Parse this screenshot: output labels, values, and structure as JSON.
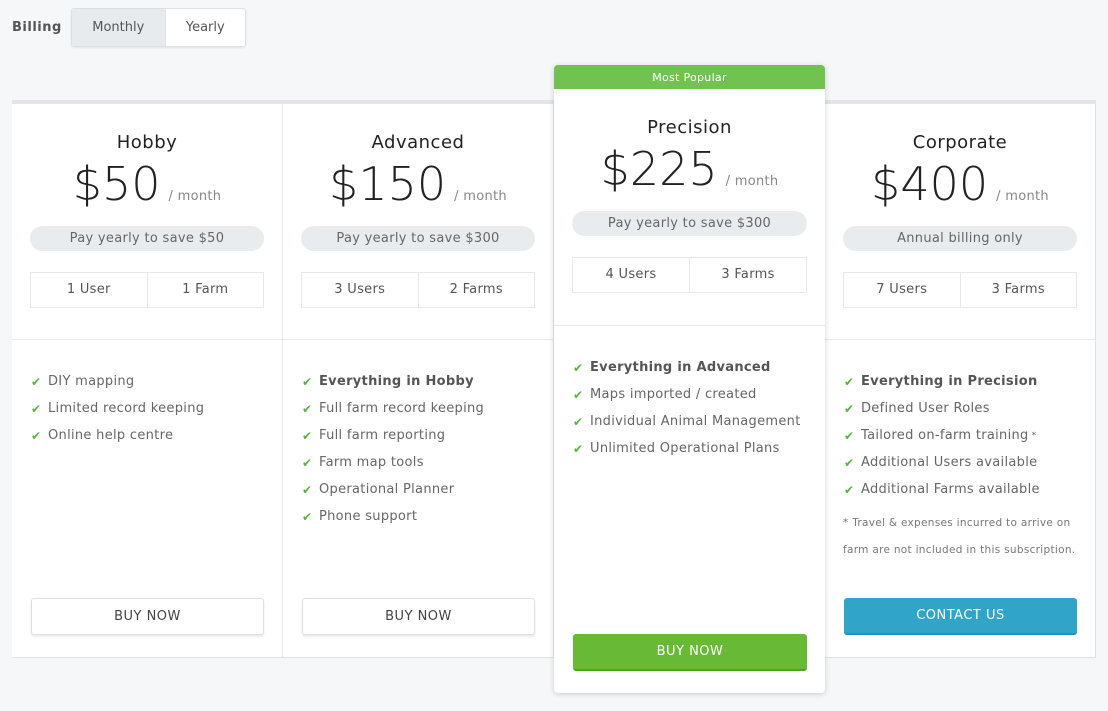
{
  "billing": {
    "label": "Billing",
    "options": [
      {
        "label": "Monthly",
        "active": true
      },
      {
        "label": "Yearly",
        "active": false
      }
    ]
  },
  "plans": [
    {
      "name": "Hobby",
      "price": "$50",
      "period": "/ month",
      "save_text": "Pay yearly to save $50",
      "users": "1 User",
      "farms": "1 Farm",
      "features": [
        {
          "text": "DIY mapping",
          "bold": false
        },
        {
          "text": "Limited record keeping",
          "bold": false
        },
        {
          "text": "Online help centre",
          "bold": false
        }
      ],
      "button": "BUY NOW"
    },
    {
      "name": "Advanced",
      "price": "$150",
      "period": "/ month",
      "save_text": "Pay yearly to save $300",
      "users": "3 Users",
      "farms": "2 Farms",
      "features": [
        {
          "text": "Everything in Hobby",
          "bold": true
        },
        {
          "text": "Full farm record keeping",
          "bold": false
        },
        {
          "text": "Full farm reporting",
          "bold": false
        },
        {
          "text": "Farm map tools",
          "bold": false
        },
        {
          "text": "Operational Planner",
          "bold": false
        },
        {
          "text": "Phone support",
          "bold": false
        }
      ],
      "button": "BUY NOW"
    },
    {
      "badge": "Most Popular",
      "name": "Precision",
      "price": "$225",
      "period": "/ month",
      "save_text": "Pay yearly to save $300",
      "users": "4 Users",
      "farms": "3 Farms",
      "features": [
        {
          "text": "Everything in Advanced",
          "bold": true
        },
        {
          "text": "Maps imported / created",
          "bold": false
        },
        {
          "text": "Individual Animal Management",
          "bold": false
        },
        {
          "text": "Unlimited Operational Plans",
          "bold": false
        }
      ],
      "button": "BUY NOW"
    },
    {
      "name": "Corporate",
      "price": "$400",
      "period": "/ month",
      "save_text": "Annual billing only",
      "users": "7 Users",
      "farms": "3 Farms",
      "features": [
        {
          "text": "Everything in Precision",
          "bold": true
        },
        {
          "text": "Defined User Roles",
          "bold": false
        },
        {
          "text": "Tailored on-farm training",
          "bold": false,
          "mark": "*"
        },
        {
          "text": "Additional Users available",
          "bold": false
        },
        {
          "text": "Additional Farms available",
          "bold": false
        }
      ],
      "note": "* Travel & expenses incurred to arrive on farm are not included in this subscription.",
      "button": "CONTACT US"
    }
  ],
  "icons": {
    "check": "✔"
  },
  "colors": {
    "popular_green": "#72c251",
    "buy_green": "#67b936",
    "contact_blue": "#31a5c8",
    "check_green": "#5ab040"
  }
}
